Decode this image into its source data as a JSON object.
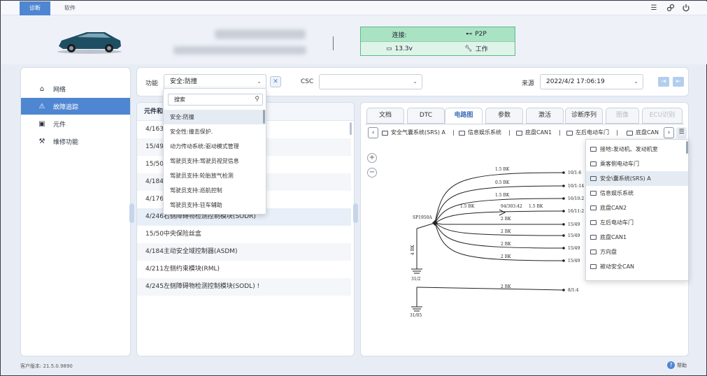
{
  "topbar": {
    "tabs": [
      {
        "label": "诊断",
        "active": true
      },
      {
        "label": "软件",
        "active": false
      }
    ],
    "icons": [
      "menu-icon",
      "link-icon",
      "power-icon"
    ]
  },
  "connection": {
    "label": "连接:",
    "mode": "P2P",
    "voltage": "13.3v",
    "state": "工作",
    "colors": {
      "top": "#a9e3c3",
      "bottom": "#dff4e8",
      "border": "#5fb98a"
    }
  },
  "sidebar": {
    "items": [
      {
        "label": "网络",
        "icon": "network-icon",
        "active": false
      },
      {
        "label": "故障追踪",
        "icon": "warning-icon",
        "active": true
      },
      {
        "label": "元件",
        "icon": "component-icon",
        "active": false
      },
      {
        "label": "维修功能",
        "icon": "wrench-icon",
        "active": false
      }
    ]
  },
  "filter": {
    "function_label": "功能",
    "function_value": "安全:防撞",
    "csc_label": "CSC",
    "csc_value": "",
    "source_label": "来源",
    "source_value": "2022/4/2  17:06:19"
  },
  "function_dropdown": {
    "search_placeholder": "搜索",
    "items": [
      "安全:防撞",
      "安全性:撞击保护.",
      "动力传动系统:驱动模式管理",
      "驾驶员支持:驾驶员视觉信息",
      "驾驶员支持:轮胎放气检测",
      "驾驶员支持:巡航控制",
      "驾驶员支持:驻车辅助"
    ],
    "selected_index": 0
  },
  "component_list": {
    "header": "元件和",
    "rows": [
      "4/163",
      "15/49",
      "15/50",
      "4/184",
      "4/176",
      "4/246右侧障碍物检测控制模块(SODR)",
      "15/50中央保险丝盒",
      "4/184主动安全域控制器(ASDM)",
      "4/211左侧约束模块(RML)",
      "4/245左侧障碍物检测控制模块(SODL) !"
    ]
  },
  "diag_tabs": [
    {
      "label": "文档",
      "state": "normal"
    },
    {
      "label": "DTC",
      "state": "normal"
    },
    {
      "label": "电路图",
      "state": "active"
    },
    {
      "label": "参数",
      "state": "normal"
    },
    {
      "label": "激活",
      "state": "normal"
    },
    {
      "label": "诊断序列",
      "state": "normal"
    },
    {
      "label": "图像",
      "state": "disabled"
    },
    {
      "label": "ECU识别",
      "state": "disabled"
    }
  ],
  "breadcrumbs": [
    "安全气囊系统(SRS) A",
    "信息娱乐系统",
    "底盘CAN1",
    "左后电动车门",
    "底盘CAN"
  ],
  "system_dropdown": {
    "items": [
      "接地:发动机、发动机室",
      "乘客侧电动车门",
      "安全\\囊系统(SRS) A",
      "信息娱乐系统",
      "底盘CAN2",
      "左后电动车门",
      "底盘CAN1",
      "方向盘",
      "被动安全CAN"
    ],
    "selected_index": 2
  },
  "schematic": {
    "splice": "SP1950A",
    "splice_wire": "4 BK",
    "ground_left": "31/2",
    "ground_bottom": "31/05",
    "bottom_wire": {
      "gauge": "2  BK",
      "end": "8/1:4"
    },
    "middle_label": "94/303:42",
    "wires": [
      {
        "gauge": "1.5  BK",
        "end": "10/1:6"
      },
      {
        "gauge": "0.5  BK",
        "end": "10/1:14"
      },
      {
        "gauge": "1.5  BK",
        "end": "16/10:2"
      },
      {
        "gauge": "1.5  BK",
        "gauge2": "1.5  BK",
        "end": "16/11:2"
      },
      {
        "gauge": "2  BK",
        "end": "15/49"
      },
      {
        "gauge": "2  BK",
        "end": "15/49"
      },
      {
        "gauge": "2  BK",
        "end": "15/49"
      },
      {
        "gauge": "2  BK",
        "end": "15/49"
      }
    ]
  },
  "footer": {
    "version": "客户版本: 21.5.0.9890",
    "help": "帮助"
  }
}
